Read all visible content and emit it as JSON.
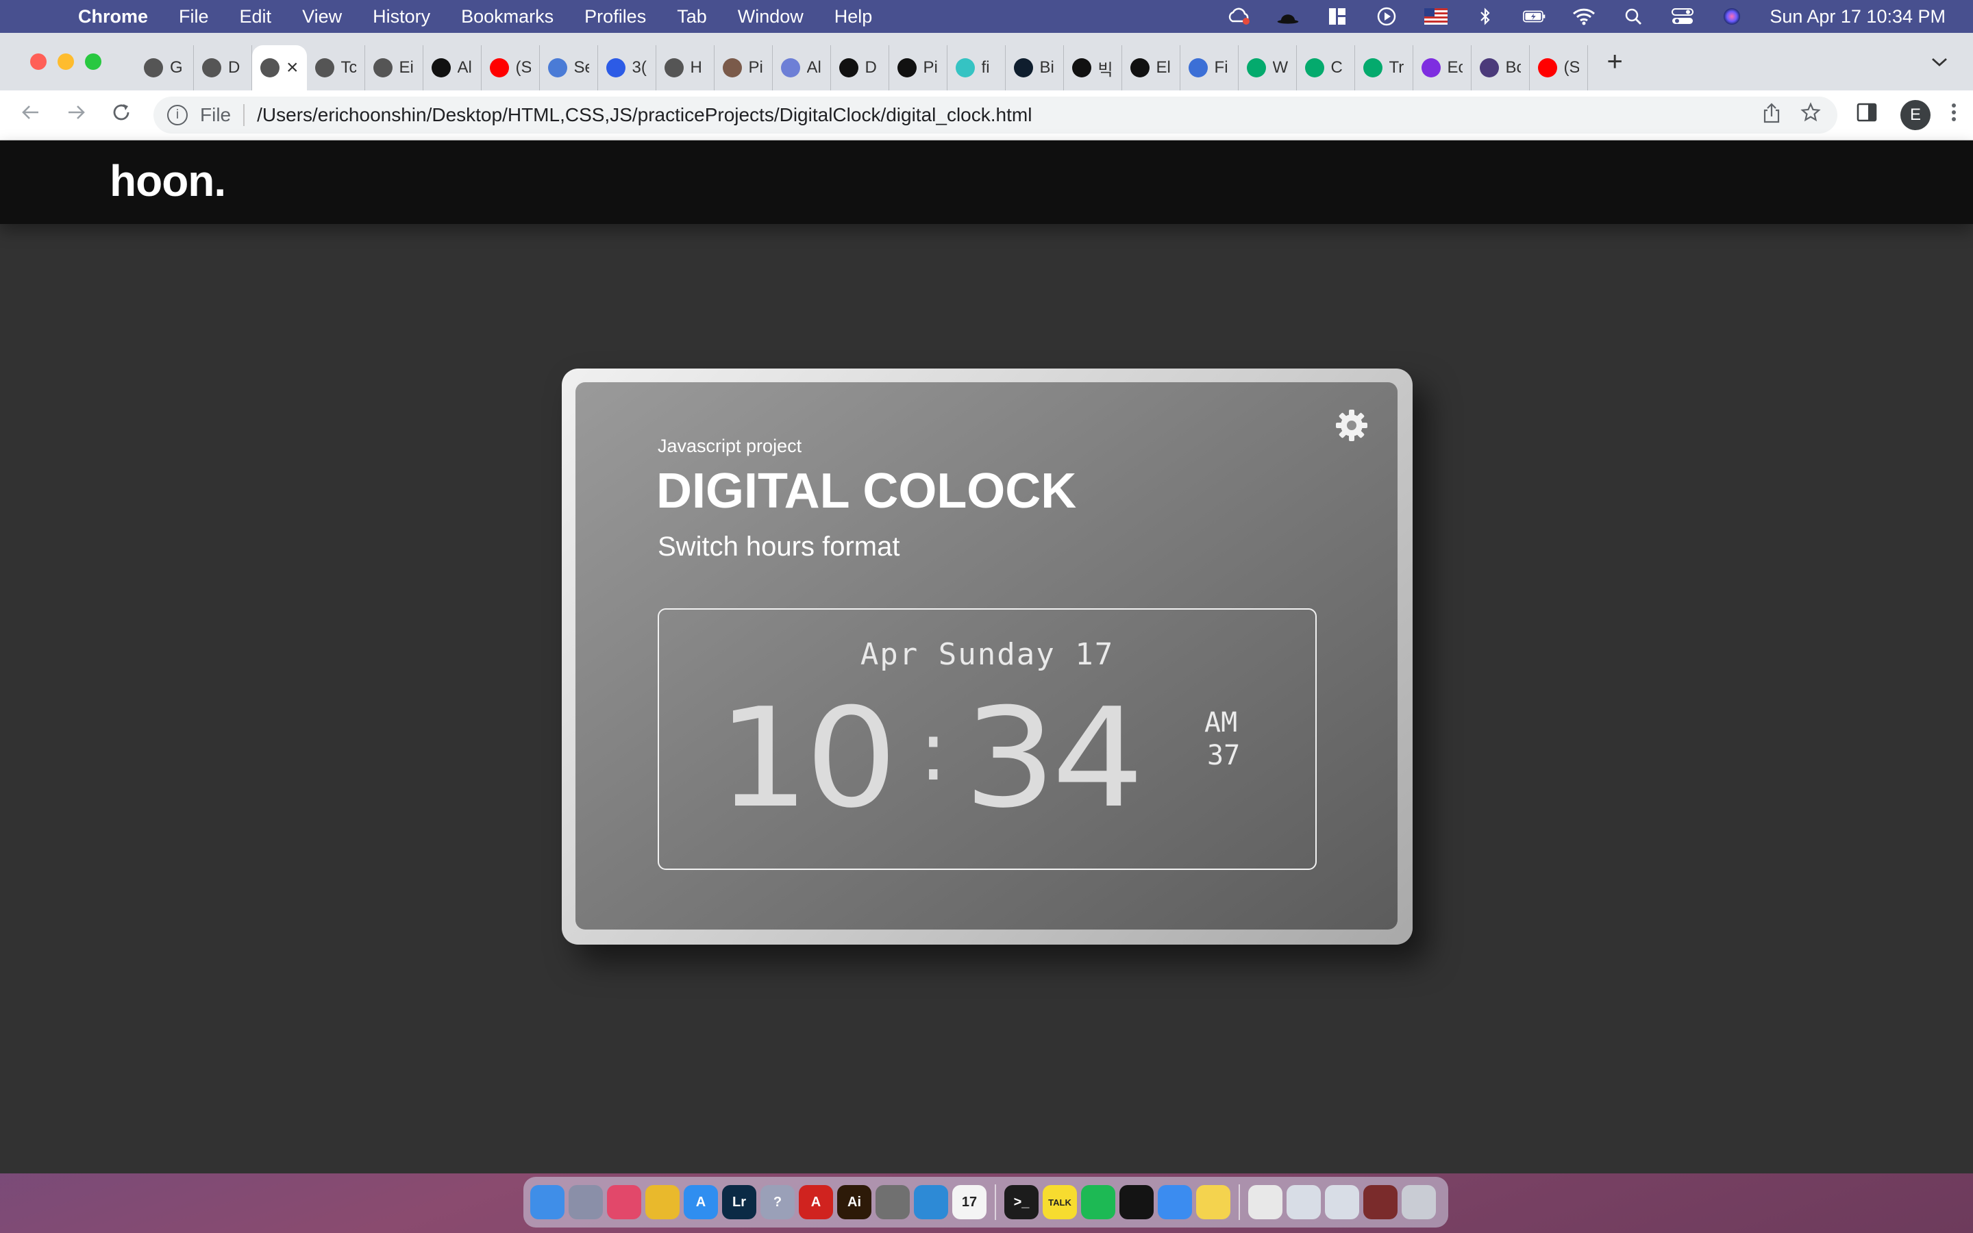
{
  "menubar": {
    "app": "Chrome",
    "items": [
      "File",
      "Edit",
      "View",
      "History",
      "Bookmarks",
      "Profiles",
      "Tab",
      "Window",
      "Help"
    ],
    "clock": "Sun Apr 17  10:34 PM"
  },
  "tabs": [
    {
      "label": "G",
      "icon": "globe-icon",
      "color": "#555555"
    },
    {
      "label": "D",
      "icon": "globe-icon",
      "color": "#555555"
    },
    {
      "label": "",
      "icon": "globe-icon",
      "color": "#555555",
      "active": true
    },
    {
      "label": "Tc",
      "icon": "globe-icon",
      "color": "#555555"
    },
    {
      "label": "Ei",
      "icon": "globe-icon",
      "color": "#555555"
    },
    {
      "label": "Al",
      "icon": "bars-icon",
      "color": "#111111"
    },
    {
      "label": "(S",
      "icon": "youtube-icon",
      "color": "#ff0000"
    },
    {
      "label": "Se",
      "icon": "flag-icon",
      "color": "#4a7bd6"
    },
    {
      "label": "3(",
      "icon": "diamond-icon",
      "color": "#2c5be6"
    },
    {
      "label": "H",
      "icon": "globe-icon",
      "color": "#555555"
    },
    {
      "label": "Pi",
      "icon": "avatar-icon",
      "color": "#7a5a4a"
    },
    {
      "label": "Al",
      "icon": "mountain-icon",
      "color": "#6d7fd6"
    },
    {
      "label": "D",
      "icon": "a-logo-icon",
      "color": "#111111"
    },
    {
      "label": "Pi",
      "icon": "cw-icon",
      "color": "#111111"
    },
    {
      "label": "fi",
      "icon": "hex-icon",
      "color": "#35c3c3"
    },
    {
      "label": "Bi",
      "icon": "b-circle-icon",
      "color": "#0f1e2e"
    },
    {
      "label": "빅",
      "icon": "wix-icon",
      "color": "#111111"
    },
    {
      "label": "El",
      "icon": "wix-icon",
      "color": "#111111"
    },
    {
      "label": "Fi",
      "icon": "robot-icon",
      "color": "#3b6fd6"
    },
    {
      "label": "W",
      "icon": "w3-icon",
      "color": "#04aa6d"
    },
    {
      "label": "C",
      "icon": "w3-icon",
      "color": "#04aa6d"
    },
    {
      "label": "Tr",
      "icon": "w3-icon",
      "color": "#04aa6d"
    },
    {
      "label": "Ec",
      "icon": "bootstrap-icon",
      "color": "#7e2ee0"
    },
    {
      "label": "Bc",
      "icon": "bootstrap-icon",
      "color": "#4b3a7a"
    },
    {
      "label": "(S",
      "icon": "youtube-icon",
      "color": "#ff0000"
    }
  ],
  "toolbar": {
    "scheme": "File",
    "url": "/Users/erichoonshin/Desktop/HTML,CSS,JS/practiceProjects/DigitalClock/digital_clock.html",
    "profile_initial": "E"
  },
  "site": {
    "logo": "hoon."
  },
  "card": {
    "kicker": "Javascript project",
    "title": "DIGITAL COLOCK",
    "switch_label": "Switch hours format"
  },
  "clock": {
    "date": "Apr Sunday 17",
    "hours": "10",
    "separator": ":",
    "minutes": "34",
    "ampm": "AM",
    "seconds": "37"
  },
  "dock": [
    {
      "name": "finder",
      "color": "#3f8ee8",
      "label": ""
    },
    {
      "name": "launchpad",
      "color": "#8a8fa8",
      "label": ""
    },
    {
      "name": "creative-cloud",
      "color": "#e2486a",
      "label": ""
    },
    {
      "name": "chrome",
      "color": "#e9b92c",
      "label": ""
    },
    {
      "name": "app-store",
      "color": "#2f8ef0",
      "label": "A"
    },
    {
      "name": "lightroom",
      "color": "#0b2a45",
      "label": "Lr"
    },
    {
      "name": "help",
      "color": "#9aa0b8",
      "label": "?"
    },
    {
      "name": "acrobat",
      "color": "#d0231f",
      "label": "A"
    },
    {
      "name": "illustrator",
      "color": "#2d1a08",
      "label": "Ai"
    },
    {
      "name": "system-preferences",
      "color": "#707070",
      "label": ""
    },
    {
      "name": "vscode",
      "color": "#2d8ad6",
      "label": ""
    },
    {
      "name": "calendar",
      "color": "#f4f4f4",
      "label": "17"
    },
    {
      "name": "terminal",
      "color": "#1c1c1c",
      "label": ">_"
    },
    {
      "name": "kakaotalk",
      "color": "#f7dc2f",
      "label": "TALK"
    },
    {
      "name": "spotify",
      "color": "#1db954",
      "label": ""
    },
    {
      "name": "iterm",
      "color": "#141414",
      "label": ""
    },
    {
      "name": "mail",
      "color": "#3b8cf0",
      "label": ""
    },
    {
      "name": "notes",
      "color": "#f4d34e",
      "label": ""
    },
    {
      "name": "doc-file",
      "color": "#e8e8e8",
      "label": ""
    },
    {
      "name": "screenshot-1",
      "color": "#d8dde6",
      "label": ""
    },
    {
      "name": "screenshot-2",
      "color": "#d8dde6",
      "label": ""
    },
    {
      "name": "photo-booth",
      "color": "#7a2b2b",
      "label": ""
    },
    {
      "name": "trash",
      "color": "#c9ccd4",
      "label": ""
    }
  ]
}
